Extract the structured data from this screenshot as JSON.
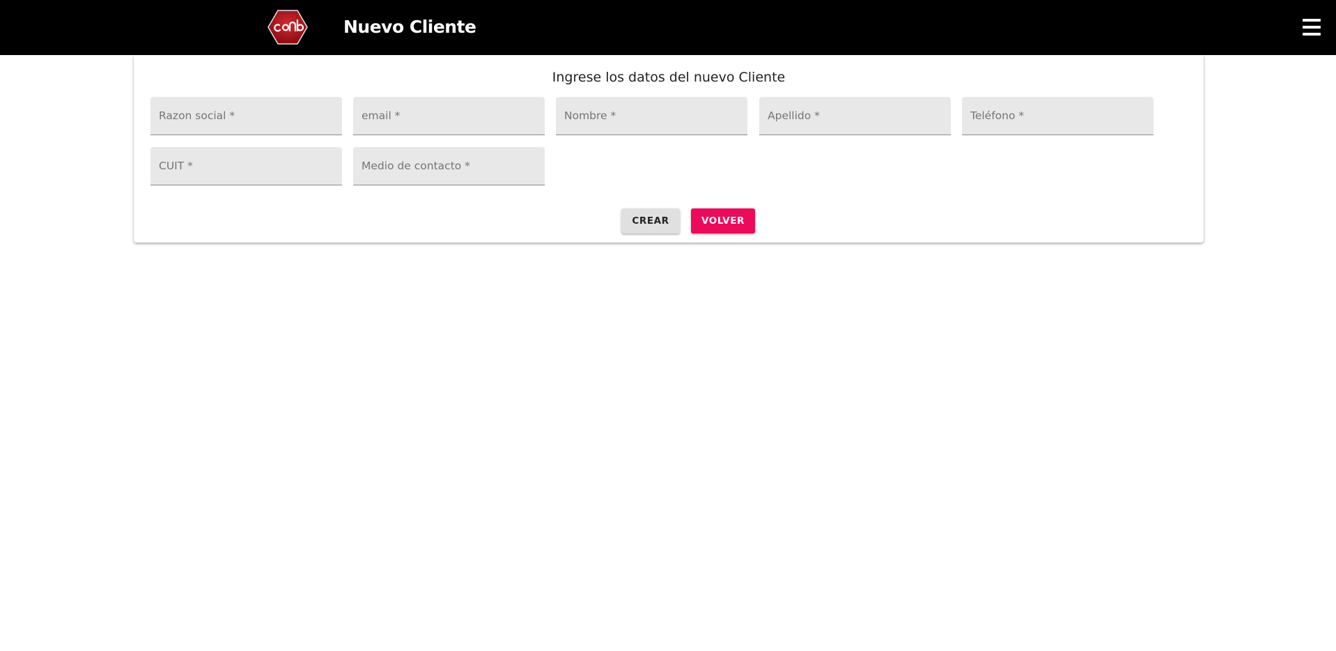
{
  "header": {
    "title": "Nuevo Cliente",
    "logo_icon": "conb-hexagon-logo-icon",
    "menu_icon": "hamburger-menu-icon",
    "background_color": "#000000",
    "logo_color": "#b5161e"
  },
  "form": {
    "heading": "Ingrese los datos del nuevo Cliente",
    "fields": [
      {
        "placeholder": "Razon social *",
        "value": ""
      },
      {
        "placeholder": "email *",
        "value": ""
      },
      {
        "placeholder": "Nombre *",
        "value": ""
      },
      {
        "placeholder": "Apellido *",
        "value": ""
      },
      {
        "placeholder": "Teléfono *",
        "value": ""
      },
      {
        "placeholder": "CUIT *",
        "value": ""
      },
      {
        "placeholder": "Medio de contacto *",
        "value": ""
      }
    ],
    "buttons": {
      "create_label": "CREAR",
      "back_label": "VOLVER",
      "back_color": "#ee0a5a"
    }
  }
}
